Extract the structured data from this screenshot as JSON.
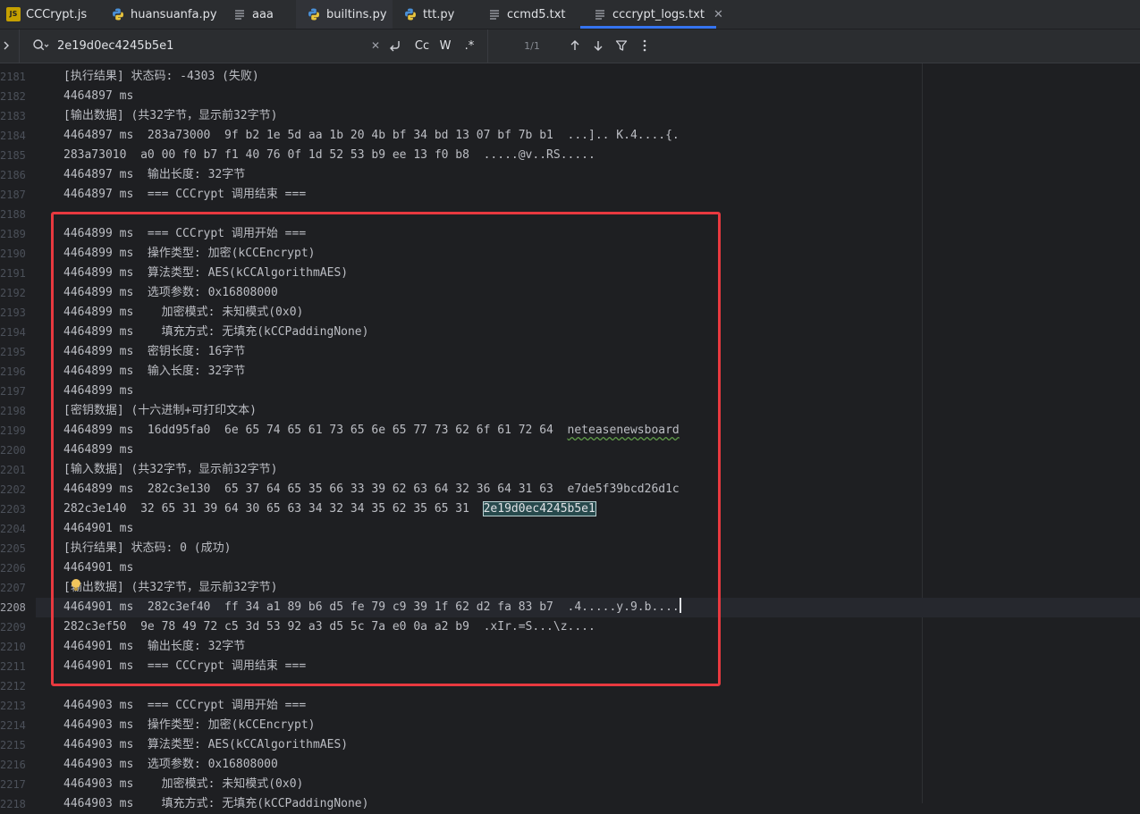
{
  "tabs": [
    {
      "label": "CCCrypt.js",
      "icon": "js-file-icon",
      "name": "tab-cccrypt-js",
      "active": false,
      "closable": false
    },
    {
      "label": "huansuanfa.py",
      "icon": "python-file-icon",
      "name": "tab-huansuanfa-py",
      "active": false,
      "closable": false
    },
    {
      "label": "aaa",
      "icon": "text-file-icon",
      "name": "tab-aaa",
      "active": false,
      "closable": false
    },
    {
      "label": "builtins.py",
      "icon": "python-file-icon",
      "name": "tab-builtins-py",
      "active": false,
      "closable": false
    },
    {
      "label": "ttt.py",
      "icon": "python-file-icon",
      "name": "tab-ttt-py",
      "active": false,
      "closable": false
    },
    {
      "label": "ccmd5.txt",
      "icon": "text-file-icon",
      "name": "tab-ccmd5-txt",
      "active": false,
      "closable": false
    },
    {
      "label": "cccrypt_logs.txt",
      "icon": "text-file-icon",
      "name": "tab-cccrypt-logs-txt",
      "active": true,
      "closable": true
    }
  ],
  "find": {
    "query": "2e19d0ec4245b5e1",
    "match_case_label": "Cc",
    "words_label": "W",
    "regex_label": ".*",
    "match_count": "1/1"
  },
  "colors": {
    "accent": "#3574f0",
    "highlight_box": "#e8393f",
    "search_match": "#27494c",
    "background": "#1e1f22",
    "toolbar": "#2b2d30"
  },
  "editor": {
    "current_line": "2208",
    "lines": [
      {
        "n": "2181",
        "text": "[执行结果] 状态码: -4303 (失败)"
      },
      {
        "n": "2182",
        "text": "4464897 ms"
      },
      {
        "n": "2183",
        "text": "[输出数据] (共32字节，显示前32字节)"
      },
      {
        "n": "2184",
        "text": "4464897 ms  283a73000  9f b2 1e 5d aa 1b 20 4b bf 34 bd 13 07 bf 7b b1  ...].. K.4....{."
      },
      {
        "n": "2185",
        "text": "283a73010  a0 00 f0 b7 f1 40 76 0f 1d 52 53 b9 ee 13 f0 b8  .....@v..RS....."
      },
      {
        "n": "2186",
        "text": "4464897 ms  输出长度: 32字节"
      },
      {
        "n": "2187",
        "text": "4464897 ms  === CCCrypt 调用结束 ==="
      },
      {
        "n": "2188",
        "text": ""
      },
      {
        "n": "2189",
        "text": "4464899 ms  === CCCrypt 调用开始 ==="
      },
      {
        "n": "2190",
        "text": "4464899 ms  操作类型: 加密(kCCEncrypt)"
      },
      {
        "n": "2191",
        "text": "4464899 ms  算法类型: AES(kCCAlgorithmAES)"
      },
      {
        "n": "2192",
        "text": "4464899 ms  选项参数: 0x16808000"
      },
      {
        "n": "2193",
        "text": "4464899 ms    加密模式: 未知模式(0x0)"
      },
      {
        "n": "2194",
        "text": "4464899 ms    填充方式: 无填充(kCCPaddingNone)"
      },
      {
        "n": "2195",
        "text": "4464899 ms  密钥长度: 16字节"
      },
      {
        "n": "2196",
        "text": "4464899 ms  输入长度: 32字节"
      },
      {
        "n": "2197",
        "text": "4464899 ms"
      },
      {
        "n": "2198",
        "text": "[密钥数据] (十六进制+可打印文本)"
      },
      {
        "n": "2199",
        "text": "4464899 ms  16dd95fa0  6e 65 74 65 61 73 65 6e 65 77 73 62 6f 61 72 64  ",
        "spell": "neteasenewsboard"
      },
      {
        "n": "2200",
        "text": "4464899 ms"
      },
      {
        "n": "2201",
        "text": "[输入数据] (共32字节，显示前32字节)"
      },
      {
        "n": "2202",
        "text": "4464899 ms  282c3e130  65 37 64 65 35 66 33 39 62 63 64 32 36 64 31 63  e7de5f39bcd26d1c"
      },
      {
        "n": "2203",
        "text": "282c3e140  32 65 31 39 64 30 65 63 34 32 34 35 62 35 65 31  ",
        "match": "2e19d0ec4245b5e1"
      },
      {
        "n": "2204",
        "text": "4464901 ms"
      },
      {
        "n": "2205",
        "text": "[执行结果] 状态码: 0 (成功)"
      },
      {
        "n": "2206",
        "text": "4464901 ms"
      },
      {
        "n": "2207",
        "text": "[输出数据] (共32字节，显示前32字节)"
      },
      {
        "n": "2208",
        "text": "4464901 ms  282c3ef40  ff 34 a1 89 b6 d5 fe 79 c9 39 1f 62 d2 fa 83 b7  .4.....y.9.b...."
      },
      {
        "n": "2209",
        "text": "282c3ef50  9e 78 49 72 c5 3d 53 92 a3 d5 5c 7a e0 0a a2 b9  .xIr.=S...\\z...."
      },
      {
        "n": "2210",
        "text": "4464901 ms  输出长度: 32字节"
      },
      {
        "n": "2211",
        "text": "4464901 ms  === CCCrypt 调用结束 ==="
      },
      {
        "n": "2212",
        "text": ""
      },
      {
        "n": "2213",
        "text": "4464903 ms  === CCCrypt 调用开始 ==="
      },
      {
        "n": "2214",
        "text": "4464903 ms  操作类型: 加密(kCCEncrypt)"
      },
      {
        "n": "2215",
        "text": "4464903 ms  算法类型: AES(kCCAlgorithmAES)"
      },
      {
        "n": "2216",
        "text": "4464903 ms  选项参数: 0x16808000"
      },
      {
        "n": "2217",
        "text": "4464903 ms    加密模式: 未知模式(0x0)"
      },
      {
        "n": "2218",
        "text": "4464903 ms    填充方式: 无填充(kCCPaddingNone)"
      }
    ]
  }
}
